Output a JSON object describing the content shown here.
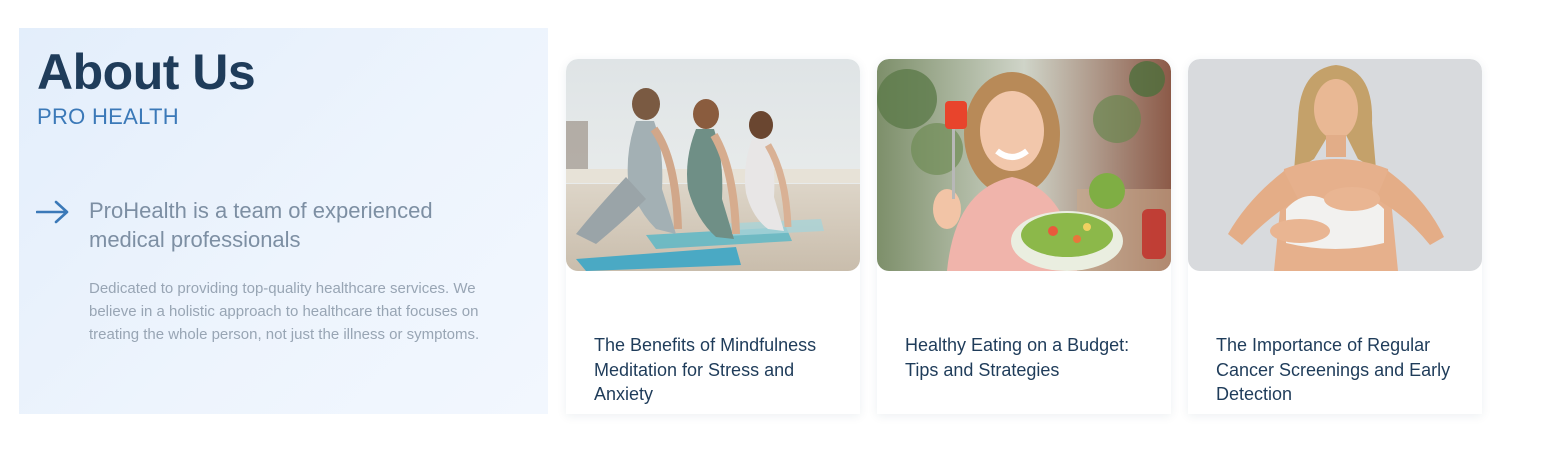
{
  "about": {
    "title": "About Us",
    "subtitle": "PRO HEALTH",
    "lead": "ProHealth is a team of experienced medical professionals",
    "body": "Dedicated to providing top-quality healthcare services. We believe in a holistic approach to healthcare that focuses on treating the whole person, not just the illness or symptoms.",
    "arrow_icon": "arrow-right-icon"
  },
  "posts": [
    {
      "title": "The Benefits of Mindfulness Meditation for Stress and Anxiety",
      "image": "yoga-beach-photo"
    },
    {
      "title": "Healthy Eating on a Budget: Tips and Strategies",
      "image": "woman-eating-salad-photo"
    },
    {
      "title": "The Importance of Regular Cancer Screenings and Early Detection",
      "image": "breast-self-exam-photo"
    }
  ],
  "colors": {
    "heading": "#1f3c5a",
    "accent": "#3b79b8",
    "panel_background": "#e8f1fc",
    "muted_text": "#7d8fa3"
  }
}
